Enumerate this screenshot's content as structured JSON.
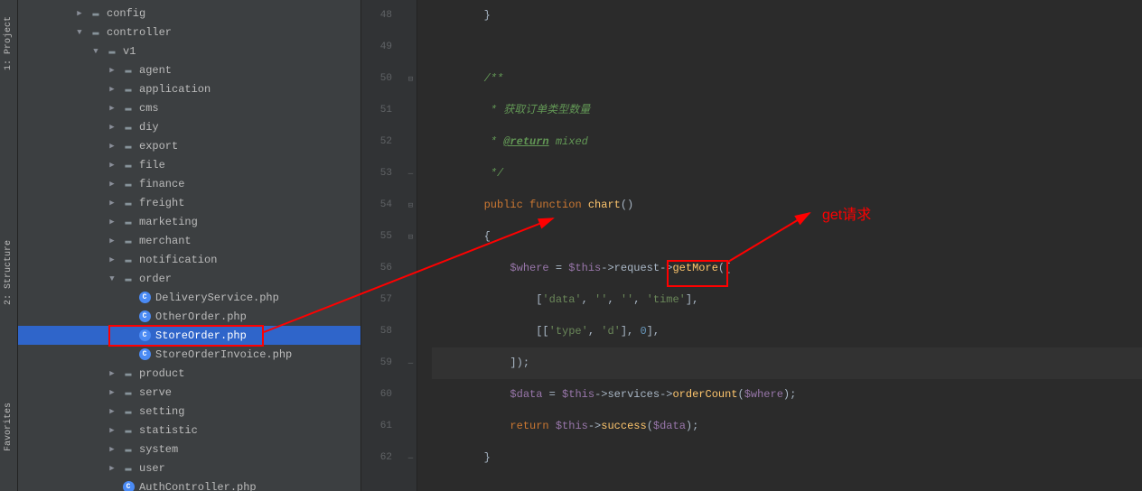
{
  "toolTabs": {
    "project": "1: Project",
    "structure": "2: Structure",
    "favorites": "Favorites"
  },
  "tree": {
    "config": "config",
    "controller": "controller",
    "v1": "v1",
    "agent": "agent",
    "application": "application",
    "cms": "cms",
    "diy": "diy",
    "export": "export",
    "file": "file",
    "finance": "finance",
    "freight": "freight",
    "marketing": "marketing",
    "merchant": "merchant",
    "notification": "notification",
    "order": "order",
    "deliveryService": "DeliveryService.php",
    "otherOrder": "OtherOrder.php",
    "storeOrder": "StoreOrder.php",
    "storeOrderInvoice": "StoreOrderInvoice.php",
    "product": "product",
    "serve": "serve",
    "setting": "setting",
    "statistic": "statistic",
    "system": "system",
    "user": "user",
    "authController": "AuthController.php"
  },
  "code": {
    "lines": [
      "48",
      "49",
      "50",
      "51",
      "52",
      "53",
      "54",
      "55",
      "56",
      "57",
      "58",
      "59",
      "60",
      "61",
      "62"
    ],
    "c48": "}",
    "c50_1": "/**",
    "c51_1": " * 获取订单类型数量",
    "c52_1": " * ",
    "c52_2": "@return",
    "c52_3": " mixed",
    "c53_1": " */",
    "c54_1": "public",
    "c54_2": " function ",
    "c54_3": "chart",
    "c54_4": "()",
    "c55_1": "{",
    "c56_1": "$where",
    "c56_2": " = ",
    "c56_3": "$this",
    "c56_4": "->request->",
    "c56_5": "getMore",
    "c56_6": "([",
    "c57_1": "[",
    "c57_2": "'data'",
    "c57_3": ", ",
    "c57_4": "''",
    "c57_5": ", ",
    "c57_6": "''",
    "c57_7": ", ",
    "c57_8": "'time'",
    "c57_9": "],",
    "c58_1": "[[",
    "c58_2": "'type'",
    "c58_3": ", ",
    "c58_4": "'d'",
    "c58_5": "], ",
    "c58_6": "0",
    "c58_7": "],",
    "c59_1": "]);",
    "c60_1": "$data",
    "c60_2": " = ",
    "c60_3": "$this",
    "c60_4": "->services->",
    "c60_5": "orderCount",
    "c60_6": "(",
    "c60_7": "$where",
    "c60_8": ");",
    "c61_1": "return ",
    "c61_2": "$this",
    "c61_3": "->",
    "c61_4": "success",
    "c61_5": "(",
    "c61_6": "$data",
    "c61_7": ");",
    "c62_1": "}"
  },
  "annotation": {
    "label": "get请求"
  }
}
